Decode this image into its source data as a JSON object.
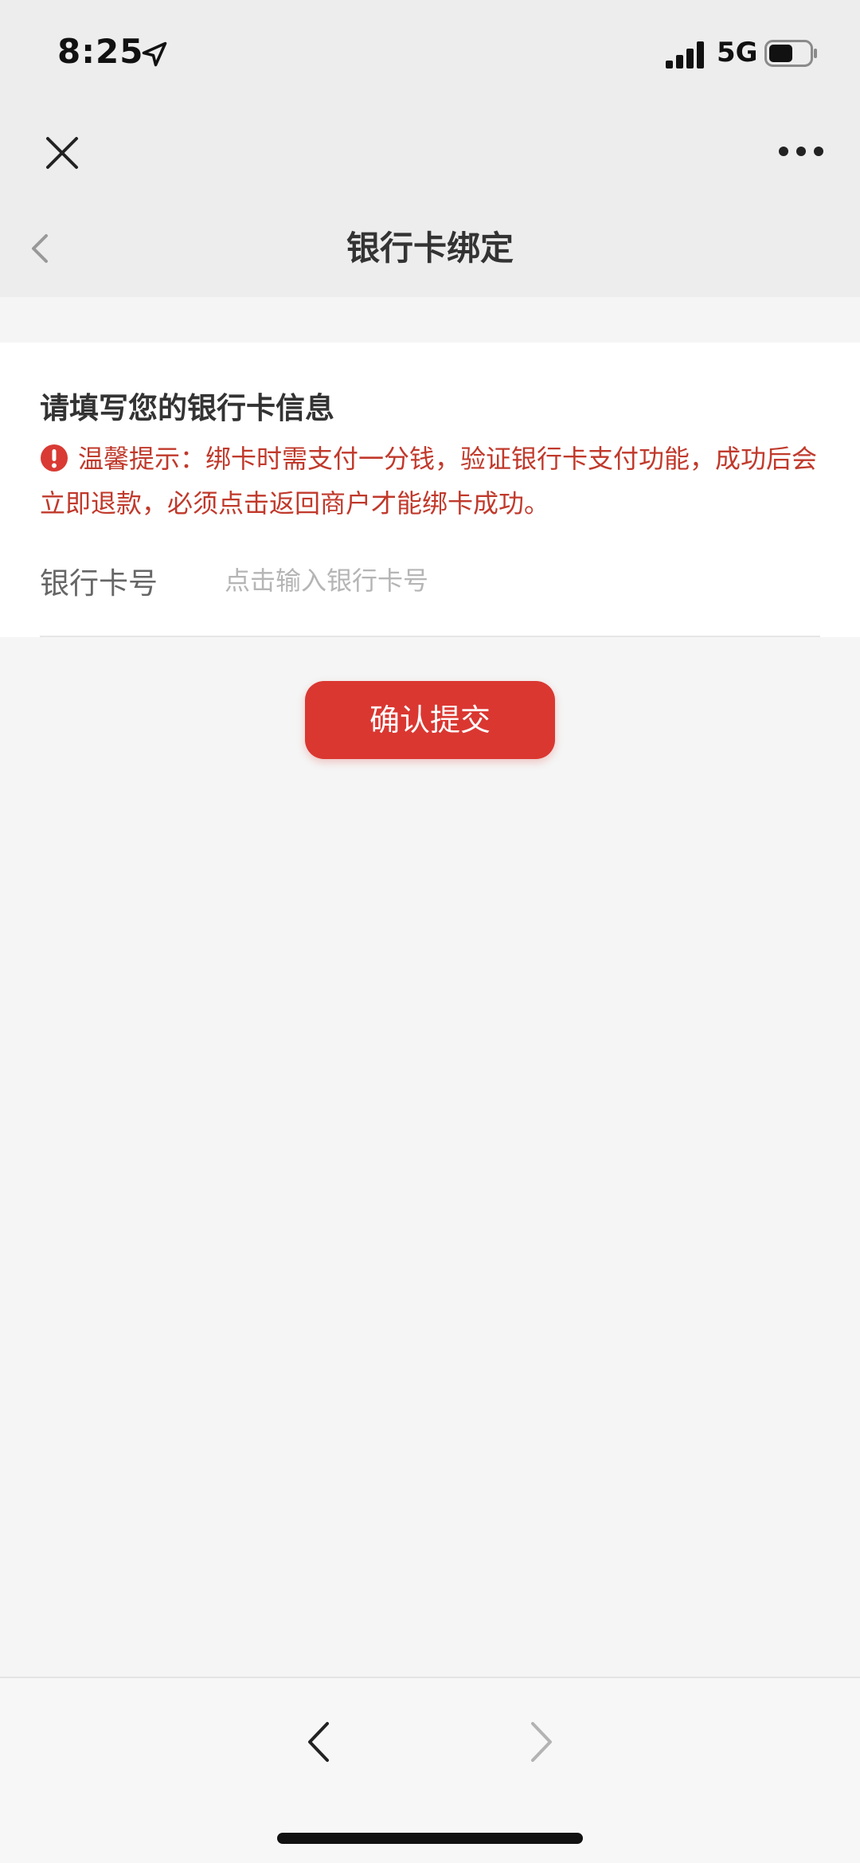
{
  "status_bar": {
    "time": "8:25",
    "network": "5G",
    "location_icon": "location-arrow-icon",
    "signal_icon": "cellular-signal-icon",
    "battery_icon": "battery-icon",
    "battery_level": 0.6
  },
  "webview_nav": {
    "close_icon": "close-icon",
    "more_icon": "more-dots-icon"
  },
  "page": {
    "title": "银行卡绑定",
    "back_icon": "chevron-left-icon"
  },
  "form": {
    "heading": "请填写您的银行卡信息",
    "notice_icon": "exclamation-circle-icon",
    "notice_text": "温馨提示：绑卡时需支付一分钱，验证银行卡支付功能，成功后会立即退款，必须点击返回商户才能绑卡成功。",
    "card_number_label": "银行卡号",
    "card_number_value": "",
    "card_number_placeholder": "点击输入银行卡号"
  },
  "submit": {
    "label": "确认提交"
  },
  "bottom_bar": {
    "back_icon": "chevron-left-icon",
    "forward_icon": "chevron-right-icon"
  },
  "colors": {
    "accent": "#da3731",
    "notice": "#c0392b",
    "nav_background": "#ededed",
    "page_background": "#f5f5f5"
  }
}
